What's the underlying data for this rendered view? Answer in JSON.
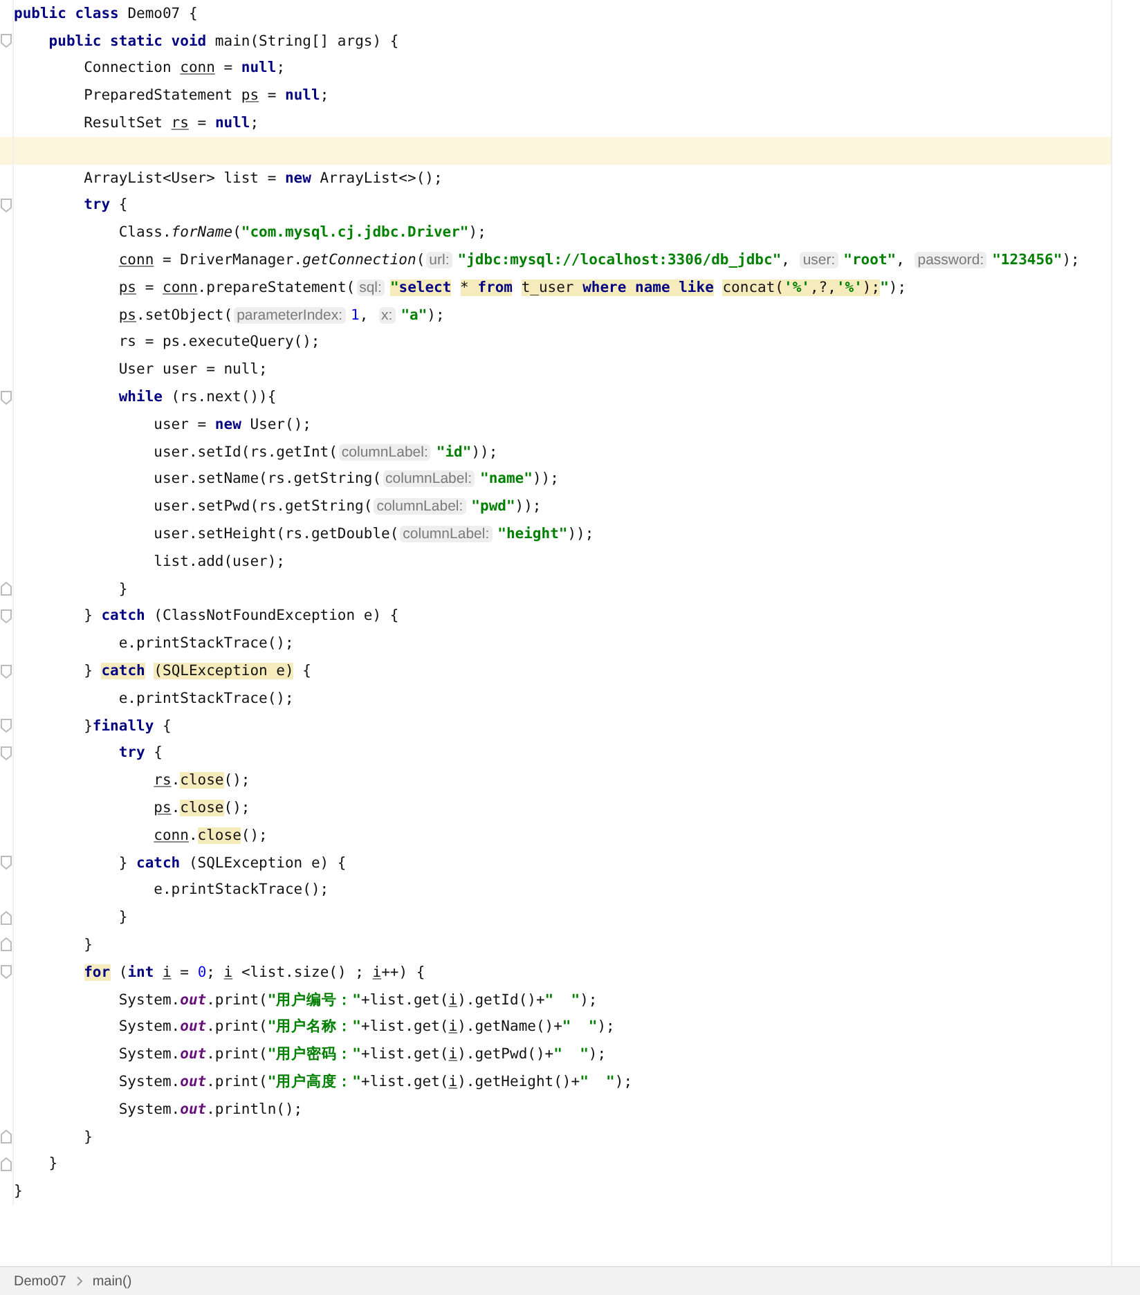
{
  "editor": {
    "lines": [
      {
        "current": false,
        "tokens": [
          {
            "kind": "keyword",
            "text": "public class"
          },
          {
            "kind": "plain",
            "text": " Demo07 {"
          }
        ]
      },
      {
        "current": false,
        "fold": {
          "kind": "start"
        },
        "tokens": [
          {
            "kind": "keyword",
            "text": "    public static void"
          },
          {
            "kind": "plain",
            "text": " main(String[] args) {"
          }
        ]
      },
      {
        "current": false,
        "tokens": [
          {
            "kind": "plain",
            "text": "        Connection "
          },
          {
            "kind": "variable",
            "text": "conn"
          },
          {
            "kind": "plain",
            "text": " = "
          },
          {
            "kind": "keyword",
            "text": "null"
          },
          {
            "kind": "plain",
            "text": ";"
          }
        ]
      },
      {
        "current": false,
        "tokens": [
          {
            "kind": "plain",
            "text": "        PreparedStatement "
          },
          {
            "kind": "variable",
            "text": "ps"
          },
          {
            "kind": "plain",
            "text": " = "
          },
          {
            "kind": "keyword",
            "text": "null"
          },
          {
            "kind": "plain",
            "text": ";"
          }
        ]
      },
      {
        "current": false,
        "tokens": [
          {
            "kind": "plain",
            "text": "        ResultSet "
          },
          {
            "kind": "variable",
            "text": "rs"
          },
          {
            "kind": "plain",
            "text": " = "
          },
          {
            "kind": "keyword",
            "text": "null"
          },
          {
            "kind": "plain",
            "text": ";"
          }
        ]
      },
      {
        "current": true
      },
      {
        "current": false,
        "tokens": [
          {
            "kind": "plain",
            "text": "        ArrayList<User> list = "
          },
          {
            "kind": "keyword",
            "text": "new"
          },
          {
            "kind": "plain",
            "text": " ArrayList<>();"
          }
        ]
      },
      {
        "current": false,
        "fold": {
          "kind": "start"
        },
        "tokens": [
          {
            "kind": "keyword",
            "text": "        try"
          },
          {
            "kind": "plain",
            "text": " {"
          }
        ]
      },
      {
        "current": false,
        "tokens": [
          {
            "kind": "plain",
            "text": "            Class."
          },
          {
            "kind": "static",
            "text": "forName"
          },
          {
            "kind": "plain",
            "text": "("
          },
          {
            "kind": "string",
            "text": "\"com.mysql.cj.jdbc.Driver\""
          },
          {
            "kind": "plain",
            "text": ");"
          }
        ]
      },
      {
        "current": false,
        "tokens": [
          {
            "kind": "variable",
            "text": "            conn"
          },
          {
            "kind": "plain",
            "text": " = DriverManager."
          },
          {
            "kind": "static",
            "text": "getConnection"
          },
          {
            "kind": "plain",
            "text": "("
          },
          {
            "kind": "hint",
            "text": "url:"
          },
          {
            "kind": "string",
            "text": "\"jdbc:mysql://localhost:3306/db_jdbc\""
          },
          {
            "kind": "plain",
            "text": ", "
          },
          {
            "kind": "hint",
            "text": "user:"
          },
          {
            "kind": "string",
            "text": "\"root\""
          },
          {
            "kind": "plain",
            "text": ", "
          },
          {
            "kind": "hint",
            "text": "password:"
          },
          {
            "kind": "string",
            "text": "\"123456\""
          },
          {
            "kind": "plain",
            "text": ");"
          }
        ]
      },
      {
        "current": false,
        "tokens": [
          {
            "kind": "variable",
            "text": "            ps"
          },
          {
            "kind": "plain",
            "text": " = "
          },
          {
            "kind": "variable",
            "text": "conn"
          },
          {
            "kind": "plain",
            "text": ".prepareStatement("
          },
          {
            "kind": "hint",
            "text": "sql:"
          },
          {
            "kind": "string",
            "text": "\"",
            "highlight": true
          },
          {
            "kind": "keyword",
            "text": "select",
            "highlight": true
          },
          {
            "kind": "plain",
            "text": " * ",
            "highlight": true
          },
          {
            "kind": "keyword",
            "text": "from",
            "highlight": true
          },
          {
            "kind": "plain",
            "text": " t_user ",
            "highlight": true
          },
          {
            "kind": "keyword",
            "text": "where name like",
            "highlight": true
          },
          {
            "kind": "plain",
            "text": " concat(",
            "highlight": true
          },
          {
            "kind": "string",
            "text": "'%'",
            "highlight": true
          },
          {
            "kind": "plain",
            "text": ",?,",
            "highlight": true
          },
          {
            "kind": "string",
            "text": "'%'",
            "highlight": true
          },
          {
            "kind": "plain",
            "text": ");",
            "highlight": true
          },
          {
            "kind": "string",
            "text": "\""
          },
          {
            "kind": "plain",
            "text": ");"
          }
        ]
      },
      {
        "current": false,
        "tokens": [
          {
            "kind": "variable",
            "text": "            ps"
          },
          {
            "kind": "plain",
            "text": ".setObject("
          },
          {
            "kind": "hint",
            "text": "parameterIndex:"
          },
          {
            "kind": "number",
            "text": "1"
          },
          {
            "kind": "plain",
            "text": ", "
          },
          {
            "kind": "hint",
            "text": "x:"
          },
          {
            "kind": "string",
            "text": "\"a\""
          },
          {
            "kind": "plain",
            "text": ");"
          }
        ]
      },
      {
        "current": false,
        "tokens": [
          {
            "kind": "plain",
            "text": "            rs = ps.executeQuery();"
          }
        ]
      },
      {
        "current": false,
        "tokens": [
          {
            "kind": "plain",
            "text": "            User user = null;"
          }
        ]
      },
      {
        "current": false,
        "fold": {
          "kind": "start"
        },
        "tokens": [
          {
            "kind": "keyword",
            "text": "            while"
          },
          {
            "kind": "plain",
            "text": " (rs.next()){"
          }
        ]
      },
      {
        "current": false,
        "tokens": [
          {
            "kind": "plain",
            "text": "                user = "
          },
          {
            "kind": "keyword",
            "text": "new"
          },
          {
            "kind": "plain",
            "text": " User();"
          }
        ]
      },
      {
        "current": false,
        "tokens": [
          {
            "kind": "plain",
            "text": "                user.setId(rs.getInt("
          },
          {
            "kind": "hint",
            "text": "columnLabel:"
          },
          {
            "kind": "string",
            "text": "\"id\""
          },
          {
            "kind": "plain",
            "text": "));"
          }
        ]
      },
      {
        "current": false,
        "tokens": [
          {
            "kind": "plain",
            "text": "                user.setName(rs.getString("
          },
          {
            "kind": "hint",
            "text": "columnLabel:"
          },
          {
            "kind": "string",
            "text": "\"name\""
          },
          {
            "kind": "plain",
            "text": "));"
          }
        ]
      },
      {
        "current": false,
        "tokens": [
          {
            "kind": "plain",
            "text": "                user.setPwd(rs.getString("
          },
          {
            "kind": "hint",
            "text": "columnLabel:"
          },
          {
            "kind": "string",
            "text": "\"pwd\""
          },
          {
            "kind": "plain",
            "text": "));"
          }
        ]
      },
      {
        "current": false,
        "tokens": [
          {
            "kind": "plain",
            "text": "                user.setHeight(rs.getDouble("
          },
          {
            "kind": "hint",
            "text": "columnLabel:"
          },
          {
            "kind": "string",
            "text": "\"height\""
          },
          {
            "kind": "plain",
            "text": "));"
          }
        ]
      },
      {
        "current": false,
        "tokens": [
          {
            "kind": "plain",
            "text": "                list.add(user);"
          }
        ]
      },
      {
        "current": false,
        "fold": {
          "kind": "end"
        },
        "tokens": [
          {
            "kind": "plain",
            "text": "            }"
          }
        ]
      },
      {
        "current": false,
        "fold": {
          "kind": "start"
        },
        "tokens": [
          {
            "kind": "plain",
            "text": "        } "
          },
          {
            "kind": "keyword",
            "text": "catch"
          },
          {
            "kind": "plain",
            "text": " (ClassNotFoundException e) {"
          }
        ]
      },
      {
        "current": false,
        "tokens": [
          {
            "kind": "plain",
            "text": "            e.printStackTrace();"
          }
        ]
      },
      {
        "current": false,
        "fold": {
          "kind": "start"
        },
        "tokens": [
          {
            "kind": "plain",
            "text": "        } "
          },
          {
            "kind": "keyword",
            "text": "catch",
            "highlight": true
          },
          {
            "kind": "plain",
            "text": " (SQLException e)",
            "highlight": true
          },
          {
            "kind": "plain",
            "text": " {"
          }
        ]
      },
      {
        "current": false,
        "tokens": [
          {
            "kind": "plain",
            "text": "            e.printStackTrace();"
          }
        ]
      },
      {
        "current": false,
        "fold": {
          "kind": "start"
        },
        "tokens": [
          {
            "kind": "plain",
            "text": "        }"
          },
          {
            "kind": "keyword",
            "text": "finally"
          },
          {
            "kind": "plain",
            "text": " {"
          }
        ]
      },
      {
        "current": false,
        "fold": {
          "kind": "start"
        },
        "tokens": [
          {
            "kind": "keyword",
            "text": "            try"
          },
          {
            "kind": "plain",
            "text": " {"
          }
        ]
      },
      {
        "current": false,
        "tokens": [
          {
            "kind": "variable",
            "text": "                rs"
          },
          {
            "kind": "plain",
            "text": "."
          },
          {
            "kind": "plain",
            "text": "close",
            "highlight": true
          },
          {
            "kind": "plain",
            "text": "();"
          }
        ]
      },
      {
        "current": false,
        "tokens": [
          {
            "kind": "variable",
            "text": "                ps"
          },
          {
            "kind": "plain",
            "text": "."
          },
          {
            "kind": "plain",
            "text": "close",
            "highlight": true
          },
          {
            "kind": "plain",
            "text": "();"
          }
        ]
      },
      {
        "current": false,
        "tokens": [
          {
            "kind": "variable",
            "text": "                conn"
          },
          {
            "kind": "plain",
            "text": "."
          },
          {
            "kind": "plain",
            "text": "close",
            "highlight": true
          },
          {
            "kind": "plain",
            "text": "();"
          }
        ]
      },
      {
        "current": false,
        "fold": {
          "kind": "start"
        },
        "tokens": [
          {
            "kind": "plain",
            "text": "            } "
          },
          {
            "kind": "keyword",
            "text": "catch"
          },
          {
            "kind": "plain",
            "text": " (SQLException e) {"
          }
        ]
      },
      {
        "current": false,
        "tokens": [
          {
            "kind": "plain",
            "text": "                e.printStackTrace();"
          }
        ]
      },
      {
        "current": false,
        "fold": {
          "kind": "end"
        },
        "tokens": [
          {
            "kind": "plain",
            "text": "            }"
          }
        ]
      },
      {
        "current": false,
        "fold": {
          "kind": "end"
        },
        "tokens": [
          {
            "kind": "plain",
            "text": "        }"
          }
        ]
      },
      {
        "current": false,
        "fold": {
          "kind": "start"
        },
        "tokens": [
          {
            "kind": "keyword",
            "text": "        for",
            "highlight": true
          },
          {
            "kind": "plain",
            "text": " ("
          },
          {
            "kind": "keyword",
            "text": "int "
          },
          {
            "kind": "variable",
            "text": "i"
          },
          {
            "kind": "plain",
            "text": " = "
          },
          {
            "kind": "number",
            "text": "0"
          },
          {
            "kind": "plain",
            "text": "; "
          },
          {
            "kind": "variable",
            "text": "i"
          },
          {
            "kind": "plain",
            "text": " <list.size() ; "
          },
          {
            "kind": "variable",
            "text": "i"
          },
          {
            "kind": "plain",
            "text": "++) {"
          }
        ]
      },
      {
        "current": false,
        "tokens": [
          {
            "kind": "plain",
            "text": "            System."
          },
          {
            "kind": "field",
            "text": "out"
          },
          {
            "kind": "plain",
            "text": ".print("
          },
          {
            "kind": "string",
            "text": "\"用户编号：\""
          },
          {
            "kind": "plain",
            "text": "+list.get("
          },
          {
            "kind": "variable",
            "text": "i"
          },
          {
            "kind": "plain",
            "text": ").getId()+"
          },
          {
            "kind": "string",
            "text": "\"  \""
          },
          {
            "kind": "plain",
            "text": ");"
          }
        ]
      },
      {
        "current": false,
        "tokens": [
          {
            "kind": "plain",
            "text": "            System."
          },
          {
            "kind": "field",
            "text": "out"
          },
          {
            "kind": "plain",
            "text": ".print("
          },
          {
            "kind": "string",
            "text": "\"用户名称：\""
          },
          {
            "kind": "plain",
            "text": "+list.get("
          },
          {
            "kind": "variable",
            "text": "i"
          },
          {
            "kind": "plain",
            "text": ").getName()+"
          },
          {
            "kind": "string",
            "text": "\"  \""
          },
          {
            "kind": "plain",
            "text": ");"
          }
        ]
      },
      {
        "current": false,
        "tokens": [
          {
            "kind": "plain",
            "text": "            System."
          },
          {
            "kind": "field",
            "text": "out"
          },
          {
            "kind": "plain",
            "text": ".print("
          },
          {
            "kind": "string",
            "text": "\"用户密码：\""
          },
          {
            "kind": "plain",
            "text": "+list.get("
          },
          {
            "kind": "variable",
            "text": "i"
          },
          {
            "kind": "plain",
            "text": ").getPwd()+"
          },
          {
            "kind": "string",
            "text": "\"  \""
          },
          {
            "kind": "plain",
            "text": ");"
          }
        ]
      },
      {
        "current": false,
        "tokens": [
          {
            "kind": "plain",
            "text": "            System."
          },
          {
            "kind": "field",
            "text": "out"
          },
          {
            "kind": "plain",
            "text": ".print("
          },
          {
            "kind": "string",
            "text": "\"用户高度：\""
          },
          {
            "kind": "plain",
            "text": "+list.get("
          },
          {
            "kind": "variable",
            "text": "i"
          },
          {
            "kind": "plain",
            "text": ").getHeight()+"
          },
          {
            "kind": "string",
            "text": "\"  \""
          },
          {
            "kind": "plain",
            "text": ");"
          }
        ]
      },
      {
        "current": false,
        "tokens": [
          {
            "kind": "plain",
            "text": "            System."
          },
          {
            "kind": "field",
            "text": "out"
          },
          {
            "kind": "plain",
            "text": ".println();"
          }
        ]
      },
      {
        "current": false,
        "fold": {
          "kind": "end"
        },
        "tokens": [
          {
            "kind": "plain",
            "text": "        }"
          }
        ]
      },
      {
        "current": false,
        "fold": {
          "kind": "end"
        },
        "tokens": [
          {
            "kind": "plain",
            "text": "    }"
          }
        ]
      },
      {
        "current": false,
        "tokens": [
          {
            "kind": "plain",
            "text": "}"
          }
        ]
      }
    ]
  },
  "breadcrumbs": [
    "Demo07",
    "main()"
  ]
}
